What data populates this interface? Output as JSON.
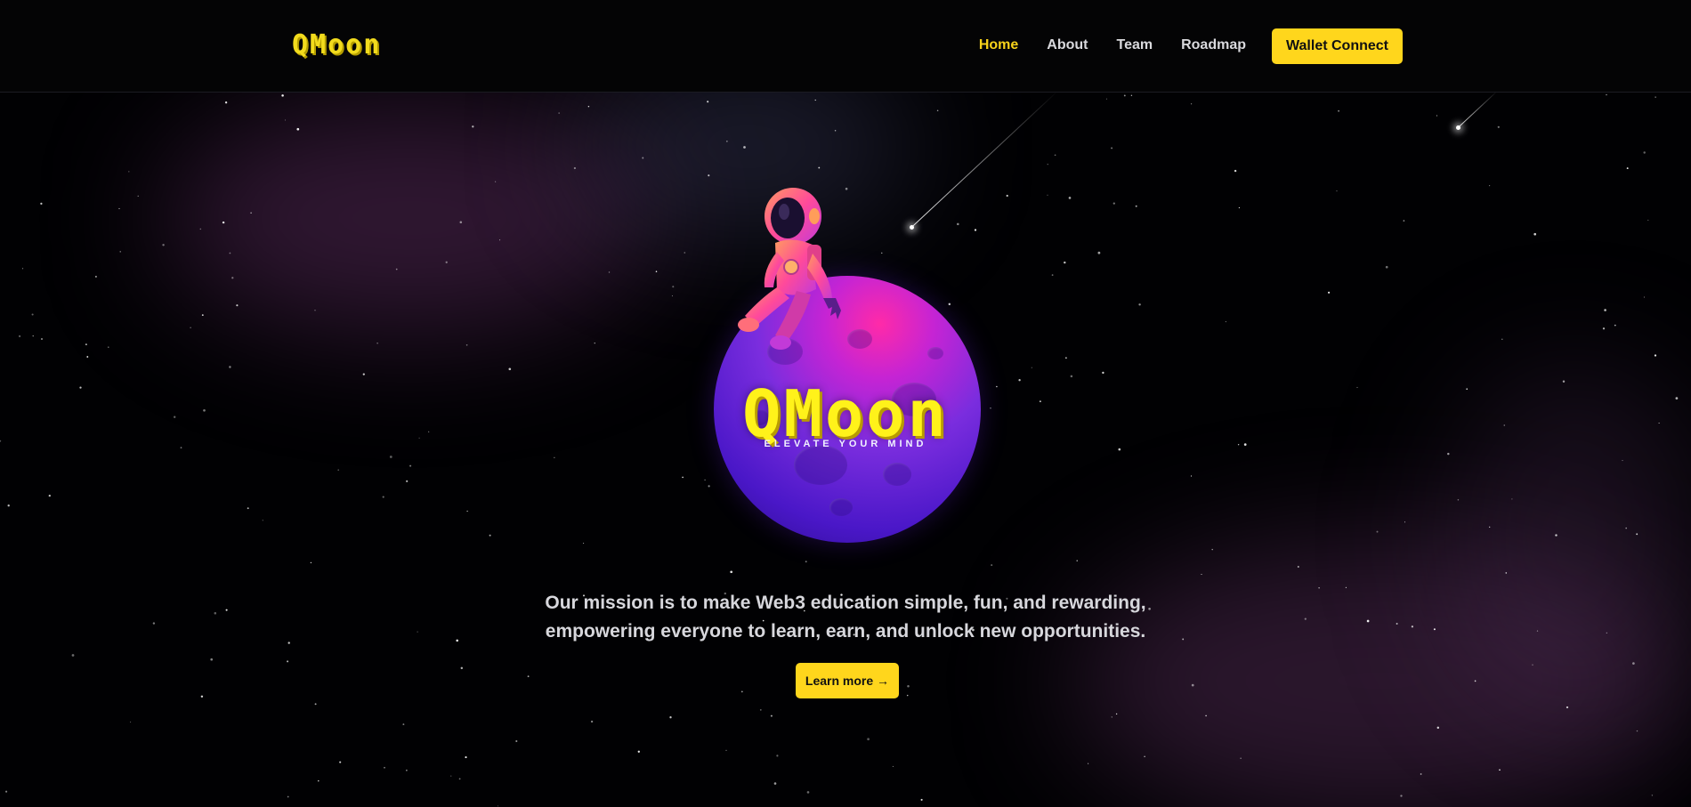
{
  "header": {
    "brand": "QMoon",
    "nav": [
      {
        "label": "Home",
        "active": true
      },
      {
        "label": "About",
        "active": false
      },
      {
        "label": "Team",
        "active": false
      },
      {
        "label": "Roadmap",
        "active": false
      }
    ],
    "cta_label": "Wallet Connect"
  },
  "hero": {
    "logo": "QMoon",
    "tagline": "ELEVATE YOUR MIND",
    "mission_line1": "Our mission is to make Web3 education simple, fun, and rewarding,",
    "mission_line2": "empowering everyone to learn, earn, and unlock new opportunities.",
    "button_label": "Learn more →"
  },
  "colors": {
    "accent": "#ffd61c",
    "background": "#000000",
    "moon_primary": "#5a1fd8",
    "moon_highlight": "#ff2aa8"
  },
  "icons": [
    "astronaut-illustration",
    "moon-illustration",
    "shooting-star"
  ]
}
